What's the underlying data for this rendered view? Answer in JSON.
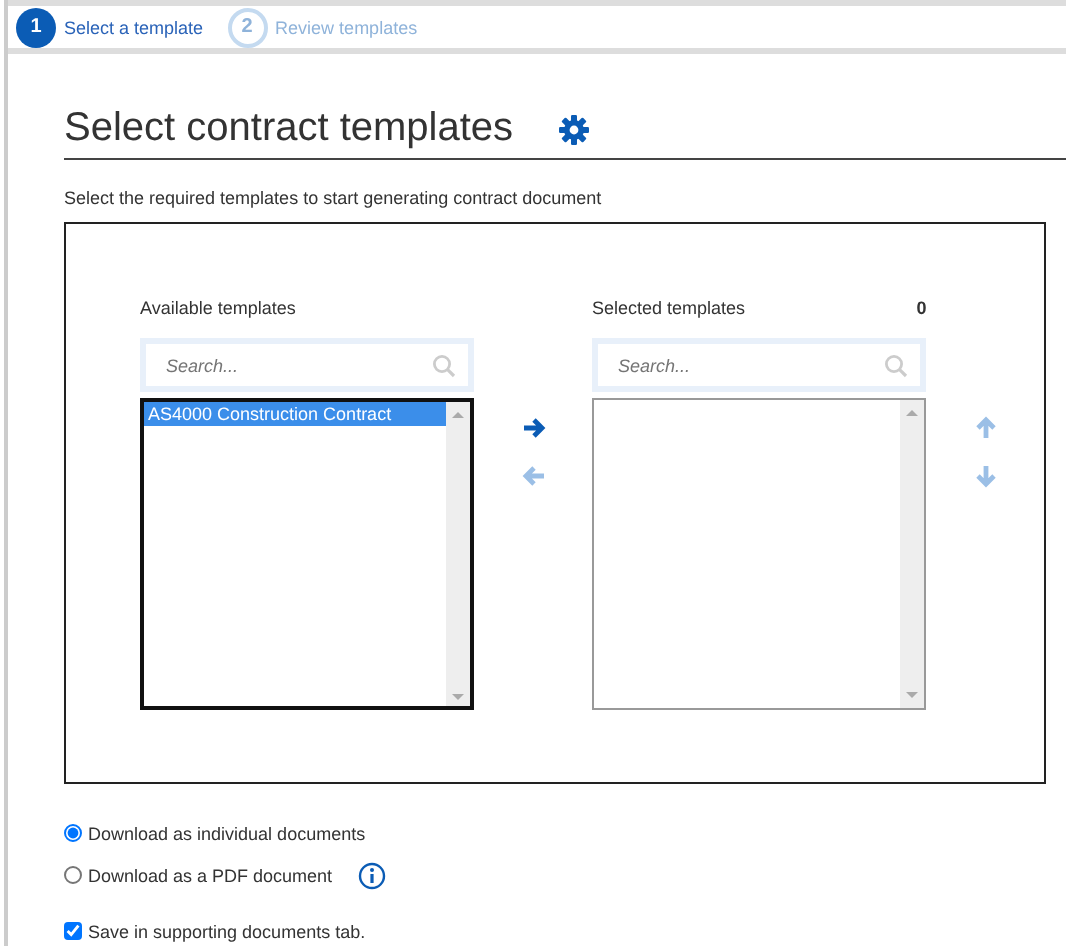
{
  "steps": [
    {
      "number": "1",
      "label": "Select a template",
      "selected": true
    },
    {
      "number": "2",
      "label": "Review templates",
      "selected": false
    }
  ],
  "heading": "Select contract templates",
  "description": "Select the required templates to start generating contract document",
  "available": {
    "label": "Available templates",
    "search": {
      "placeholder": "Search..."
    },
    "items": [
      {
        "label": "AS4000 Construction Contract",
        "selected": true
      }
    ]
  },
  "transfer_buttons": [
    {
      "kind": "right",
      "disabled": false
    },
    {
      "kind": "left",
      "disabled": true
    }
  ],
  "selected_list": {
    "label": "Selected templates",
    "count": "0",
    "search": {
      "placeholder": "Search..."
    }
  },
  "order_buttons": [
    {
      "kind": "up",
      "disabled": true
    },
    {
      "kind": "down",
      "disabled": true
    }
  ],
  "download_options": [
    {
      "label": "Download as individual documents",
      "selected": true,
      "info": false
    },
    {
      "label": "Download as a PDF document",
      "selected": false,
      "info": true
    }
  ],
  "save_option": {
    "label": "Save in supporting documents tab.",
    "checked": true
  }
}
